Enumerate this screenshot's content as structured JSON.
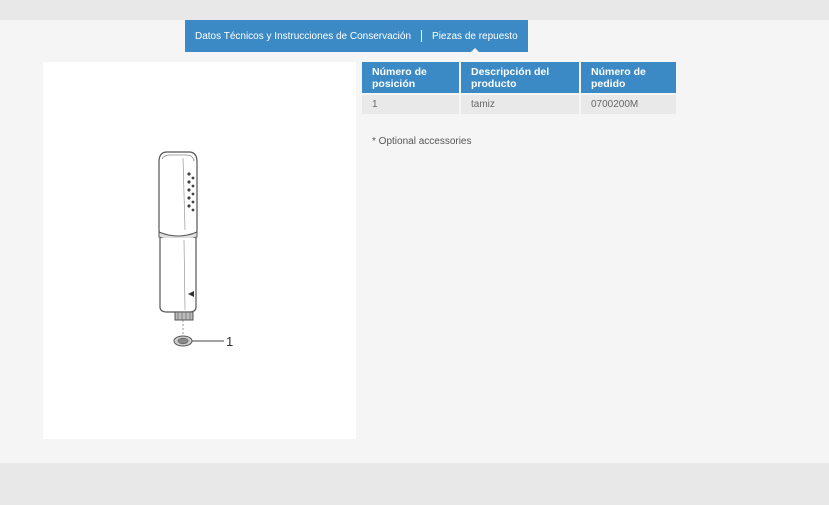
{
  "tabs": [
    {
      "label": "Datos Técnicos y Instrucciones de Conservación",
      "active": false
    },
    {
      "label": "Piezas de repuesto",
      "active": true
    }
  ],
  "figure": {
    "callouts": [
      "1"
    ]
  },
  "table": {
    "headers": [
      "Número de posición",
      "Descripción del producto",
      "Número de pedido"
    ],
    "rows": [
      [
        "1",
        "tamiz",
        "0700200M"
      ]
    ]
  },
  "note": "* Optional accessories",
  "colors": {
    "accent": "#3b8ac6",
    "row_bg": "#e9e9e9",
    "page_bg": "#f5f5f5"
  }
}
